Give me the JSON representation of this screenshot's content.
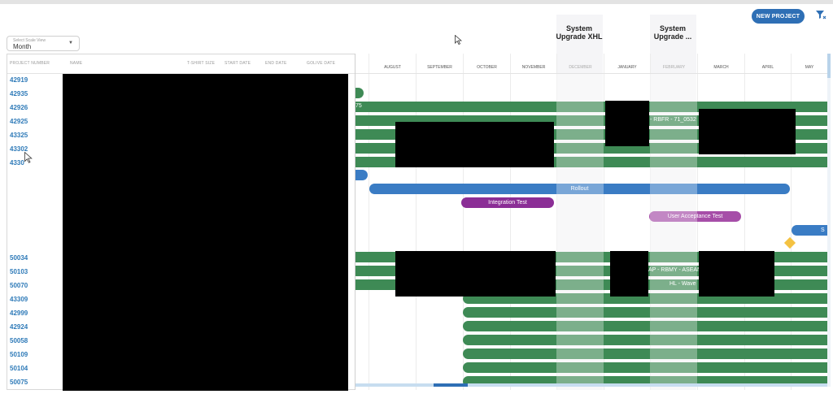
{
  "toolbar": {
    "new_project_label": "NEW PROJECT",
    "filter_icon": "filter-icon"
  },
  "scale_select": {
    "caption": "Select Scale View",
    "value": "Month"
  },
  "milestones": [
    {
      "label": "System Upgrade XHL"
    },
    {
      "label": "System Upgrade ..."
    }
  ],
  "table": {
    "columns": [
      "PROJECT NUMBER",
      "NAME",
      "T-SHIRT SIZE",
      "START DATE",
      "END DATE",
      "GOLIVE DATE"
    ],
    "rows": [
      "42919",
      "42935",
      "42926",
      "42925",
      "43325",
      "43302",
      "4330",
      "50034",
      "50103",
      "50070",
      "43309",
      "42999",
      "42924",
      "50058",
      "50109",
      "50104",
      "50075"
    ]
  },
  "timeline": {
    "months": [
      "AUGUST",
      "SEPTEMBER",
      "OCTOBER",
      "NOVEMBER",
      "DECEMBER",
      "JANUARY",
      "FEBRUARY",
      "MARCH",
      "APRIL",
      "MAY"
    ],
    "bar_labels": {
      "row3": "75",
      "row4": "- RBFR - 71_0532",
      "rollout": "Rollout",
      "integration": "Integration Test",
      "uat": "User Acceptance Test",
      "cut": "S",
      "row_50103": "AP - RBMY - ASEAN",
      "row_50070": "HL - Wave"
    }
  },
  "colors": {
    "accent_blue": "#2e6fb5",
    "bar_green": "#3e8a55",
    "bar_green_light": "#7fbf93",
    "pill_blue": "#3a7cc4",
    "pill_purple": "#8b2e96",
    "pill_pink": "#b86ab8",
    "milestone_yellow": "#f4c242"
  }
}
